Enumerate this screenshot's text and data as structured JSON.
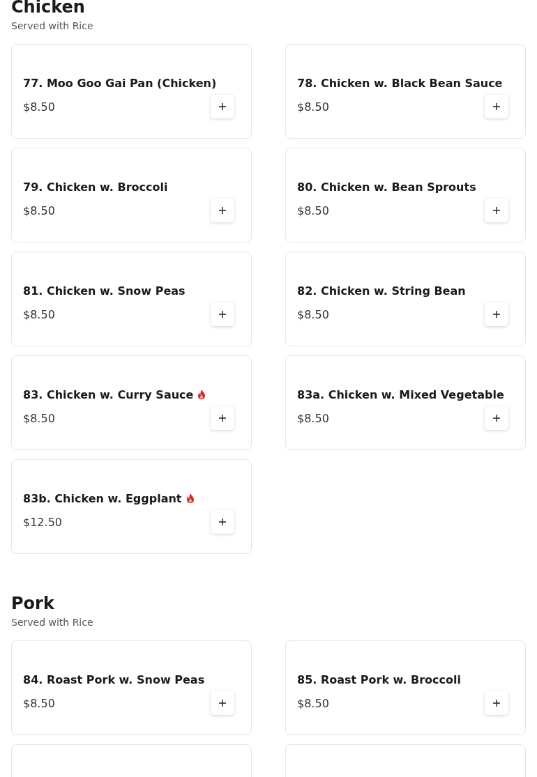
{
  "sections": [
    {
      "title": "Chicken",
      "subtitle": "Served with Rice",
      "items": [
        {
          "name": "77. Moo Goo Gai Pan (Chicken)",
          "price": "$8.50",
          "spicy": false
        },
        {
          "name": "78. Chicken w. Black Bean Sauce",
          "price": "$8.50",
          "spicy": false
        },
        {
          "name": "79. Chicken w. Broccoli",
          "price": "$8.50",
          "spicy": false
        },
        {
          "name": "80. Chicken w. Bean Sprouts",
          "price": "$8.50",
          "spicy": false
        },
        {
          "name": "81. Chicken w. Snow Peas",
          "price": "$8.50",
          "spicy": false
        },
        {
          "name": "82. Chicken w. String Bean",
          "price": "$8.50",
          "spicy": false
        },
        {
          "name": "83. Chicken w. Curry Sauce",
          "price": "$8.50",
          "spicy": true
        },
        {
          "name": "83a. Chicken w. Mixed Vegetable",
          "price": "$8.50",
          "spicy": false
        },
        {
          "name": "83b. Chicken w. Eggplant",
          "price": "$12.50",
          "spicy": true
        }
      ]
    },
    {
      "title": "Pork",
      "subtitle": "Served with Rice",
      "items": [
        {
          "name": "84. Roast Pork w. Snow Peas",
          "price": "$8.50",
          "spicy": false
        },
        {
          "name": "85. Roast Pork w. Broccoli",
          "price": "$8.50",
          "spicy": false
        },
        {
          "spicy": false
        },
        {
          "spicy": false
        }
      ]
    }
  ]
}
